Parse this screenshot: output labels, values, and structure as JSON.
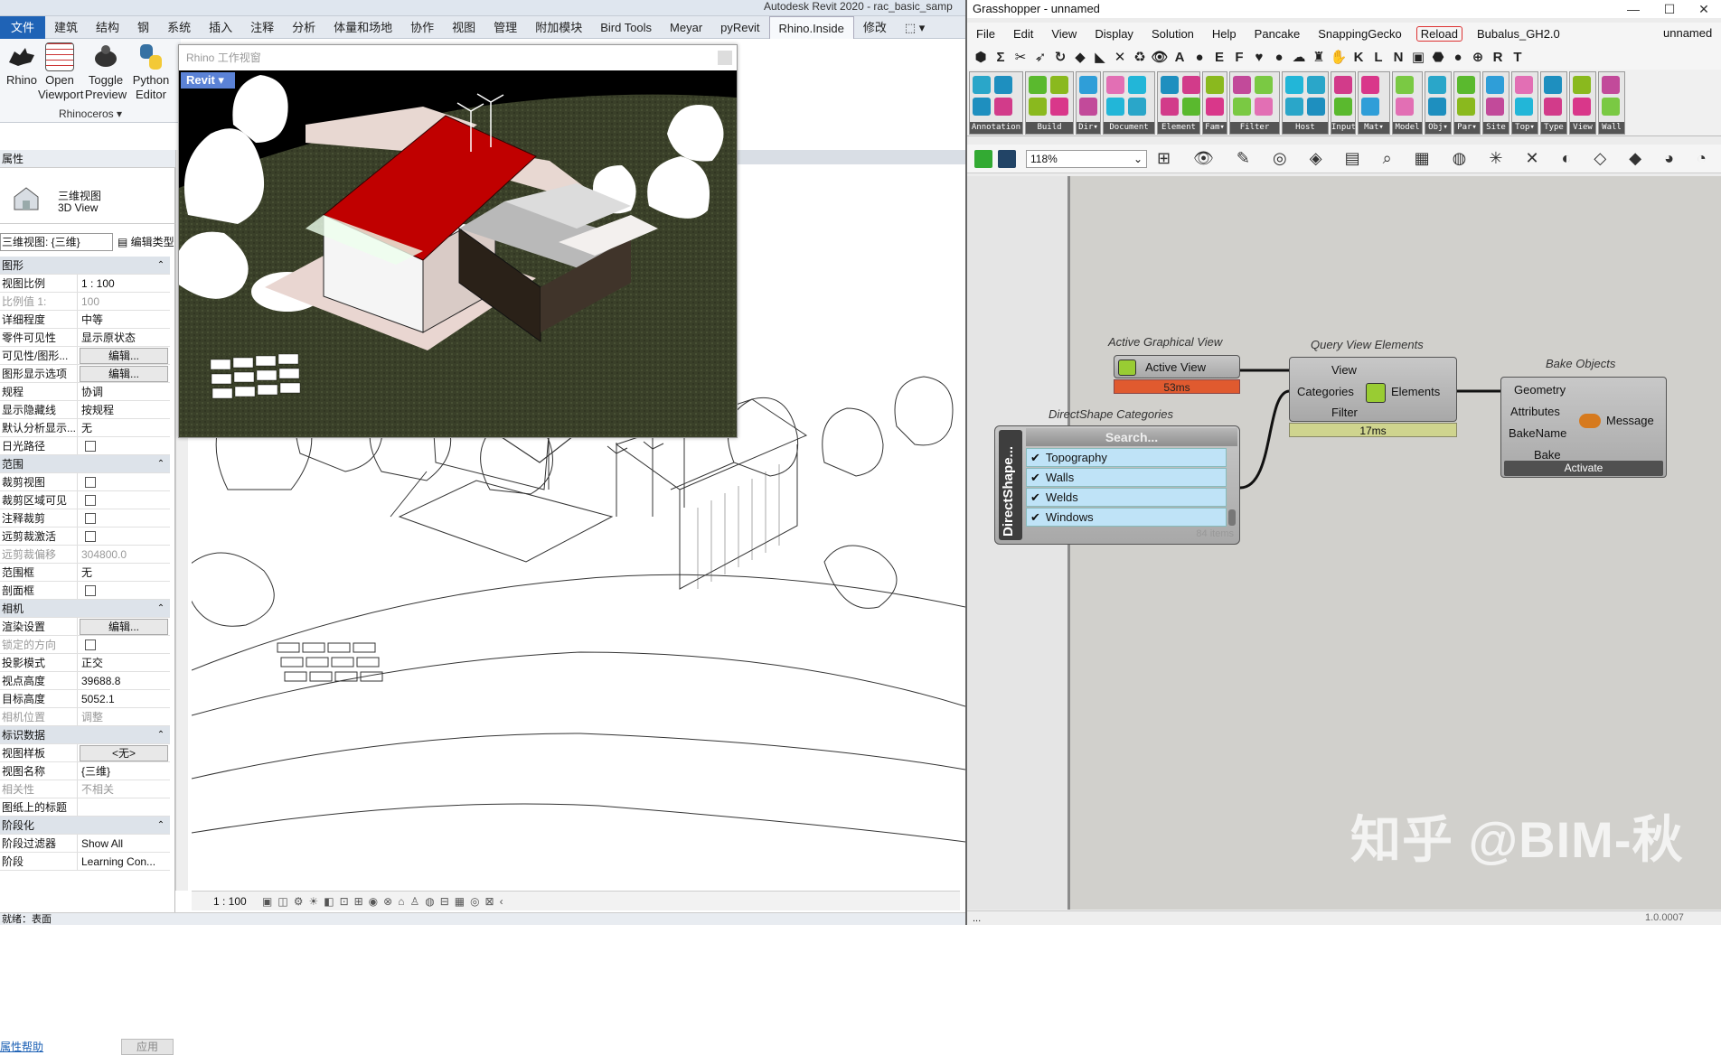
{
  "revit": {
    "title": "Autodesk Revit 2020 - rac_basic_samp",
    "tabs": [
      "文件",
      "建筑",
      "结构",
      "钢",
      "系统",
      "插入",
      "注释",
      "分析",
      "体量和场地",
      "协作",
      "视图",
      "管理",
      "附加模块",
      "Bird Tools",
      "Meyar",
      "pyRevit",
      "Rhino.Inside",
      "修改",
      "⬚ ▾"
    ],
    "ribbon": {
      "buttons": [
        {
          "label": "Rhino",
          "icon": "rhino-icon"
        },
        {
          "label": "Open\nViewport",
          "icon": "viewport-icon"
        },
        {
          "label": "Toggle\nPreview",
          "icon": "preview-icon"
        },
        {
          "label": "Python\nEditor",
          "icon": "python-icon"
        }
      ],
      "group_label": "Rhinoceros ▾"
    },
    "properties": {
      "title": "属性",
      "type_line1": "三维视图",
      "type_line2": "3D View",
      "selector": "三维视图: {三维}",
      "edit_type": "编辑类型",
      "rows": [
        {
          "kind": "head",
          "k": "图形"
        },
        {
          "k": "视图比例",
          "v": "1 : 100"
        },
        {
          "k": "比例值 1:",
          "v": "100",
          "grey": true
        },
        {
          "k": "详细程度",
          "v": "中等"
        },
        {
          "k": "零件可见性",
          "v": "显示原状态"
        },
        {
          "k": "可见性/图形...",
          "v": "编辑...",
          "btn": true
        },
        {
          "k": "图形显示选项",
          "v": "编辑...",
          "btn": true
        },
        {
          "k": "规程",
          "v": "协调"
        },
        {
          "k": "显示隐藏线",
          "v": "按规程"
        },
        {
          "k": "默认分析显示...",
          "v": "无"
        },
        {
          "k": "日光路径",
          "cb": true
        },
        {
          "kind": "head",
          "k": "范围"
        },
        {
          "k": "裁剪视图",
          "cb": true
        },
        {
          "k": "裁剪区域可见",
          "cb": true
        },
        {
          "k": "注释裁剪",
          "cb": true
        },
        {
          "k": "远剪裁激活",
          "cb": true
        },
        {
          "k": "远剪裁偏移",
          "v": "304800.0",
          "grey": true
        },
        {
          "k": "范围框",
          "v": "无"
        },
        {
          "k": "剖面框",
          "cb": true
        },
        {
          "kind": "head",
          "k": "相机"
        },
        {
          "k": "渲染设置",
          "v": "编辑...",
          "btn": true
        },
        {
          "k": "锁定的方向",
          "cb": true,
          "grey": true
        },
        {
          "k": "投影模式",
          "v": "正交"
        },
        {
          "k": "视点高度",
          "v": "39688.8"
        },
        {
          "k": "目标高度",
          "v": "5052.1"
        },
        {
          "k": "相机位置",
          "v": "调整",
          "grey": true
        },
        {
          "kind": "head",
          "k": "标识数据"
        },
        {
          "k": "视图样板",
          "v": "<无>",
          "btn": true
        },
        {
          "k": "视图名称",
          "v": "{三维}"
        },
        {
          "k": "相关性",
          "v": "不相关",
          "grey": true
        },
        {
          "k": "图纸上的标题",
          "v": ""
        },
        {
          "kind": "head",
          "k": "阶段化"
        },
        {
          "k": "阶段过滤器",
          "v": "Show All"
        },
        {
          "k": "阶段",
          "v": "Learning Con..."
        }
      ],
      "help": "属性帮助",
      "apply": "应用"
    },
    "viewbar_scale": "1 : 100",
    "status": "就绪：表面"
  },
  "rhino": {
    "title": "Rhino 工作视窗",
    "viewport_tag": "Revit"
  },
  "gh": {
    "title": "Grasshopper - unnamed",
    "menu": [
      "File",
      "Edit",
      "View",
      "Display",
      "Solution",
      "Help",
      "Pancake",
      "SnappingGecko",
      "Reload",
      "Bubalus_GH2.0"
    ],
    "doc_name": "unnamed",
    "tabs": [
      "⬢",
      "Σ",
      "✂",
      "➶",
      "↻",
      "◆",
      "◣",
      "✕",
      "♻",
      "👁",
      "A",
      "●",
      "E",
      "F",
      "♥",
      "●",
      "☁",
      "♜",
      "✋",
      "K",
      "L",
      "N",
      "▣",
      "⬣",
      "●",
      "⊕",
      "R",
      "T"
    ],
    "groups": [
      "Annotation",
      "Build",
      "Dir▾",
      "Document",
      "Element",
      "Fam▾",
      "Filter",
      "Host",
      "Input",
      "Mat▾",
      "Model",
      "Obj▾",
      "Par▾",
      "Site",
      "Top▾",
      "Type",
      "View",
      "Wall"
    ],
    "zoom": "118%",
    "nodes": {
      "active_view": {
        "label": "Active Graphical View",
        "name": "Active View",
        "time": "53ms"
      },
      "query": {
        "label": "Query View Elements",
        "inputs": [
          "View",
          "Categories",
          "Filter"
        ],
        "output": "Elements",
        "time": "17ms"
      },
      "bake": {
        "label": "Bake Objects",
        "inputs": [
          "Geometry",
          "Attributes",
          "BakeName",
          "Bake"
        ],
        "output": "Message",
        "button": "Activate"
      },
      "categories": {
        "label": "DirectShape Categories",
        "side": "DirectShape...",
        "search": "Search...",
        "items": [
          "Topography",
          "Walls",
          "Welds",
          "Windows"
        ],
        "count": "84 items"
      }
    },
    "watermark": "知乎 @BIM-秋",
    "version": "1.0.0007"
  }
}
